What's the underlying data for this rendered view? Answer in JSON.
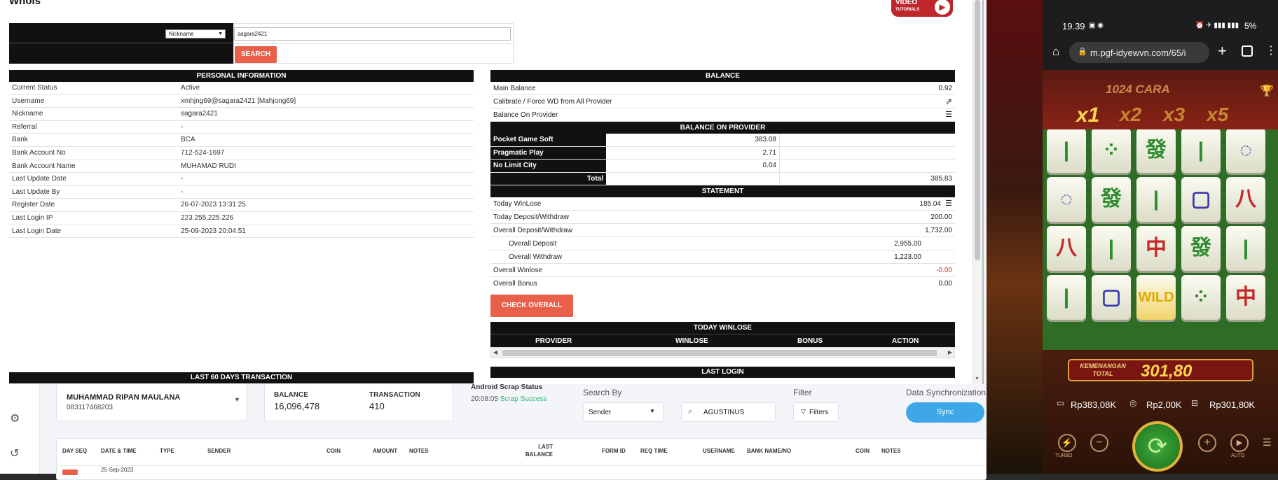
{
  "whois": {
    "title": "Whois",
    "video_badge_top": "VIDEO",
    "video_badge_bottom": "TUTORIALS",
    "search_by_selected": "Nickname",
    "search_value": "sagara2421",
    "search_button": "SEARCH",
    "personal_header": "PERSONAL INFORMATION",
    "personal": [
      {
        "k": "Current Status",
        "v": "Active"
      },
      {
        "k": "Username",
        "v": "xmhjng69@sagara2421  [Mahjong69]"
      },
      {
        "k": "Nickname",
        "v": "sagara2421"
      },
      {
        "k": "Referral",
        "v": "-"
      },
      {
        "k": "Bank",
        "v": "BCA"
      },
      {
        "k": "Bank Account No",
        "v": "712-524-1697"
      },
      {
        "k": "Bank Account Name",
        "v": "MUHAMAD RUDI"
      },
      {
        "k": "Last Update Date",
        "v": "-"
      },
      {
        "k": "Last Update By",
        "v": "-"
      },
      {
        "k": "Register Date",
        "v": "26-07-2023 13:31:25"
      },
      {
        "k": "Last Login IP",
        "v": "223.255.225.226"
      },
      {
        "k": "Last Login Date",
        "v": "25-09-2023 20:04:51"
      }
    ],
    "balance_header": "BALANCE",
    "main_balance_label": "Main Balance",
    "main_balance_value": "0.92",
    "calibrate_label": "Calibrate / Force WD from All Provider",
    "balance_on_provider_label": "Balance On Provider",
    "provider_header": "BALANCE ON PROVIDER",
    "providers": [
      {
        "name": "Pocket Game Soft",
        "value": "383.08"
      },
      {
        "name": "Pragmatic Play",
        "value": "2.71"
      },
      {
        "name": "No Limit City",
        "value": "0.04"
      }
    ],
    "total_label": "Total",
    "total_value": "385.83",
    "statement_header": "STATEMENT",
    "today_winlose_label": "Today WinLose",
    "today_winlose_value": "185.04",
    "today_dw_label": "Today Deposit/Withdraw",
    "today_dw_value": "200.00",
    "overall_dw_label": "Overall Deposit/Withdraw",
    "overall_dw_value": "1,732.00",
    "overall_deposit_label": "Overall Deposit",
    "overall_deposit_value": "2,955.00",
    "overall_withdraw_label": "Overall Withdraw",
    "overall_withdraw_value": "1,223.00",
    "overall_winlose_label": "Overall Winlose",
    "overall_winlose_value": "-0.00",
    "overall_bonus_label": "Overall Bonus",
    "overall_bonus_value": "0.00",
    "check_overall": "CHECK OVERALL",
    "today_winlose_header": "TODAY WINLOSE",
    "tw_columns": [
      "PROVIDER",
      "WINLOSE",
      "BONUS",
      "ACTION"
    ],
    "last60_header": "LAST 60 DAYS TRANSACTION",
    "last_login_header": "LAST LOGIN"
  },
  "bottom": {
    "account_name": "MUHAMMAD RIPAN MAULANA",
    "account_phone": "083117468203",
    "balance_label": "BALANCE",
    "balance_value": "16,096,478",
    "transaction_label": "TRANSACTION",
    "transaction_value": "410",
    "scrap_title": "Android Scrap Status",
    "scrap_time": "20:08:05",
    "scrap_status": "Scrap Success",
    "search_by_label": "Search By",
    "search_by_value": "Sender",
    "search_value": "AGUSTINUS",
    "filter_label": "Filter",
    "filter_button": "Filters",
    "sync_label": "Data Synchronization",
    "sync_button": "Sync",
    "columns": [
      "DAY SEQ",
      "DATE & TIME",
      "TYPE",
      "SENDER",
      "COIN",
      "AMOUNT",
      "NOTES",
      "LAST BALANCE",
      "FORM ID",
      "REQ TIME",
      "USERNAME",
      "BANK NAME/NO",
      "COIN",
      "NOTES"
    ],
    "row_date": "25-Sep-2023",
    "colors": {
      "sync": "#3ea7e8",
      "accent": "#e8604a",
      "success": "#2bb673"
    }
  },
  "phone": {
    "time": "19.39",
    "battery": "5%",
    "url": "m.pgf-idyewvn.com/65/i",
    "game_title": "1024 CARA",
    "multipliers": [
      "x1",
      "x2",
      "x3",
      "x5"
    ],
    "win_label_1": "KEMENANGAN",
    "win_label_2": "TOTAL",
    "win_value": "301,80",
    "wild": "WILD",
    "stat_balance": "Rp383,08K",
    "stat_bet": "Rp2,00K",
    "stat_win": "Rp301,80K",
    "turbo": "TURBO",
    "auto": "AUTO"
  }
}
